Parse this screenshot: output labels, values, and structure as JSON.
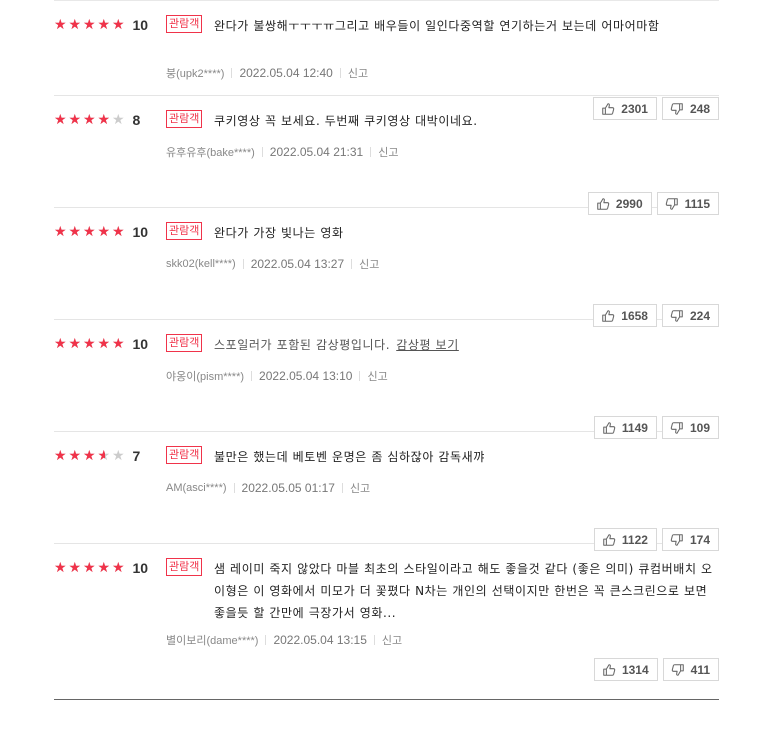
{
  "accent": "#f0334a",
  "reviews": [
    {
      "rating": 5,
      "score": "10",
      "badge": "관람객",
      "text": "완다가 불쌍해ㅜㅜㅜㅠ그리고 배우들이 일인다중역할 연기하는거 보는데 어마어마함",
      "user": "붕(upk2****)",
      "date": "2022.05.04 12:40",
      "report": "신고",
      "likes": "2301",
      "dislikes": "248",
      "spoiler": false
    },
    {
      "rating": 4,
      "score": "8",
      "badge": "관람객",
      "text": "쿠키영상 꼭 보세요. 두번째 쿠키영상 대박이네요.",
      "user": "유후유후(bake****)",
      "date": "2022.05.04 21:31",
      "report": "신고",
      "likes": "2990",
      "dislikes": "1115",
      "spoiler": false
    },
    {
      "rating": 5,
      "score": "10",
      "badge": "관람객",
      "text": "완다가 가장 빛나는 영화",
      "user": "skk02(kell****)",
      "date": "2022.05.04 13:27",
      "report": "신고",
      "likes": "1658",
      "dislikes": "224",
      "spoiler": false
    },
    {
      "rating": 5,
      "score": "10",
      "badge": "관람객",
      "text": "스포일러가 포함된 감상평입니다.",
      "link": "감상평 보기",
      "user": "야옹이(pism****)",
      "date": "2022.05.04 13:10",
      "report": "신고",
      "likes": "1149",
      "dislikes": "109",
      "spoiler": true
    },
    {
      "rating": 3.5,
      "score": "7",
      "badge": "관람객",
      "text": "불만은 했는데 베토벤 운명은 좀 심하잖아 감독새꺄",
      "user": "AM(asci****)",
      "date": "2022.05.05 01:17",
      "report": "신고",
      "likes": "1122",
      "dislikes": "174",
      "spoiler": false
    },
    {
      "rating": 5,
      "score": "10",
      "badge": "관람객",
      "text": "샘 레이미 죽지 않았다 마블 최초의 스타일이라고 해도 좋을것 같다 (좋은 의미) 큐컴버배치 오이형은 이 영화에서 미모가 더 꽃폈다 N차는 개인의 선택이지만 한번은 꼭 큰스크린으로 보면 좋을듯 할 간만에 극장가서 영화...",
      "user": "별이보리(dame****)",
      "date": "2022.05.04 13:15",
      "report": "신고",
      "likes": "1314",
      "dislikes": "411",
      "spoiler": false
    }
  ]
}
